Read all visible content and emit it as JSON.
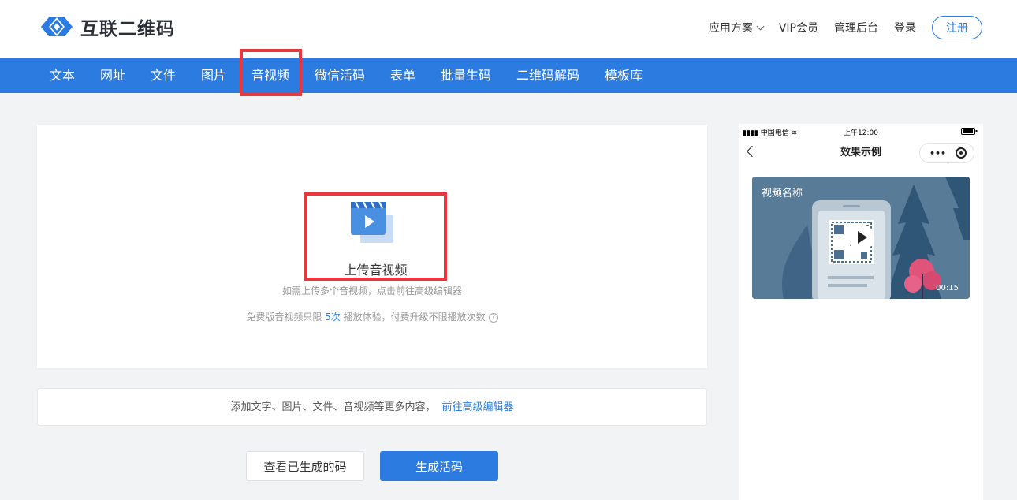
{
  "brand": {
    "name": "互联二维码",
    "accent": "#2b7be0",
    "highlight": "#e8383d"
  },
  "header": {
    "solutions": "应用方案",
    "vip": "VIP会员",
    "admin": "管理后台",
    "login": "登录",
    "register": "注册"
  },
  "nav": {
    "tabs": [
      {
        "label": "文本"
      },
      {
        "label": "网址"
      },
      {
        "label": "文件"
      },
      {
        "label": "图片"
      },
      {
        "label": "音视频",
        "active": true
      },
      {
        "label": "微信活码"
      },
      {
        "label": "表单"
      },
      {
        "label": "批量生码"
      },
      {
        "label": "二维码解码"
      },
      {
        "label": "模板库"
      }
    ]
  },
  "upload": {
    "label": "上传音视频",
    "hint_multi": "如需上传多个音视频，点击前往高级编辑器",
    "hint_free_pre": "免费版音视频只限 ",
    "hint_free_num": "5次",
    "hint_free_post": " 播放体验，付费升级不限播放次数",
    "help_icon": "question-circle-icon"
  },
  "more": {
    "text": "添加文字、图片、文件、音视频等更多内容，",
    "link": "前往高级编辑器"
  },
  "actions": {
    "view_generated": "查看已生成的码",
    "generate": "生成活码"
  },
  "preview": {
    "carrier": "中国电信",
    "time": "上午12:00",
    "title": "效果示例",
    "capsule_dots": "•••",
    "video_name": "视频名称",
    "duration": "00:15"
  }
}
